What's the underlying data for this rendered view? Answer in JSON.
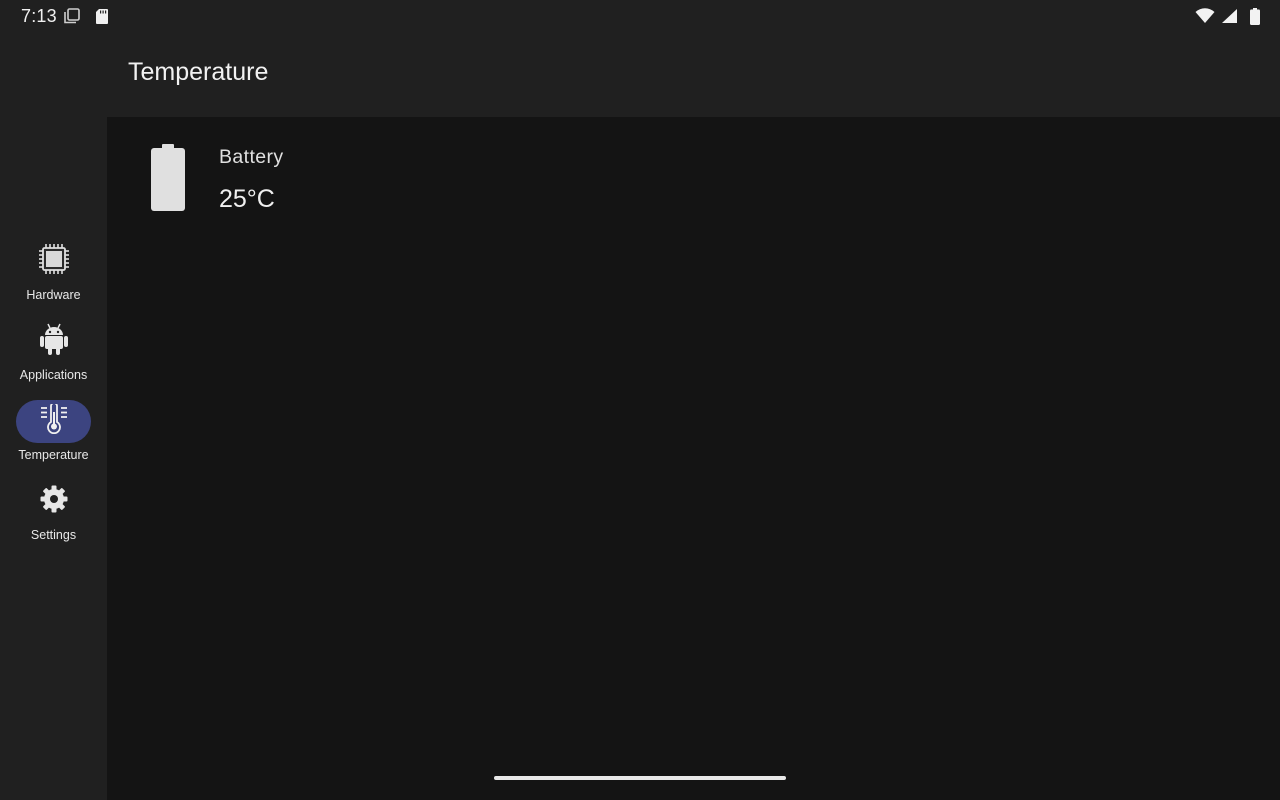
{
  "status_bar": {
    "time": "7:13",
    "left_icons": [
      "screenshot-icon",
      "sd-card-icon"
    ],
    "right_icons": [
      "wifi-icon",
      "cell-signal-icon",
      "battery-icon"
    ]
  },
  "app_bar": {
    "title": "Temperature"
  },
  "nav_rail": {
    "items": [
      {
        "label": "Hardware",
        "icon": "chip-icon",
        "active": false
      },
      {
        "label": "Applications",
        "icon": "android-icon",
        "active": false
      },
      {
        "label": "Temperature",
        "icon": "thermometer-icon",
        "active": true
      },
      {
        "label": "Settings",
        "icon": "gear-icon",
        "active": false
      }
    ]
  },
  "temperatures": [
    {
      "label": "Battery",
      "value": "25°C",
      "icon": "battery-icon"
    }
  ],
  "colors": {
    "background": "#202020",
    "content_background": "#141414",
    "active_indicator": "#3c4480",
    "text": "#e6e6e6"
  }
}
